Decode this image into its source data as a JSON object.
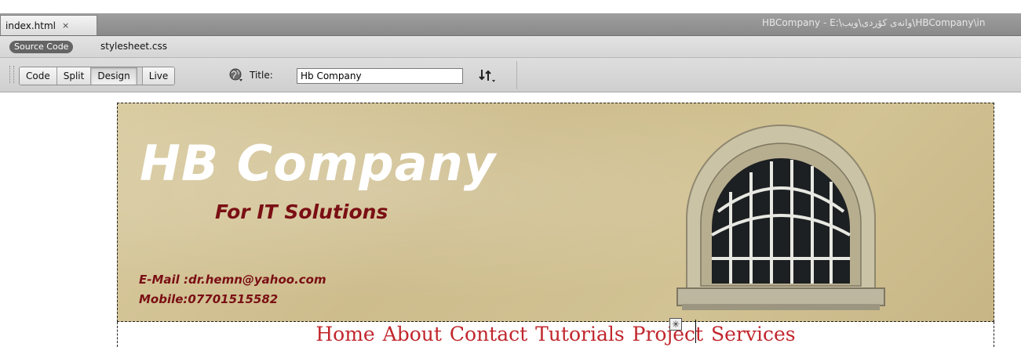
{
  "doc_tab": {
    "filename": "index.html",
    "close_glyph": "×"
  },
  "window_path": "HBCompany - E:\\وانەی کۆردی\\ویب\\HBCompany\\in",
  "related_files": {
    "source_label": "Source Code",
    "file": "stylesheet.css"
  },
  "toolbar": {
    "views": [
      "Code",
      "Split",
      "Design",
      "Live"
    ],
    "active_view": "Design",
    "title_label": "Title:",
    "title_value": "Hb Company",
    "icons": [
      "globe-icon",
      "file-management-icon"
    ]
  },
  "header": {
    "title": "HB Company",
    "subtitle": "For IT Solutions",
    "email": "E-Mail :dr.hemn@yahoo.com",
    "mobile": "Mobile:07701515582"
  },
  "nav": [
    "Home",
    "About",
    "Contact",
    "Tutorials",
    "Project",
    "Services"
  ],
  "colors": {
    "brand_red": "#7a0f14",
    "nav_red": "#c1272d",
    "banner_bg": "#d2c394"
  }
}
